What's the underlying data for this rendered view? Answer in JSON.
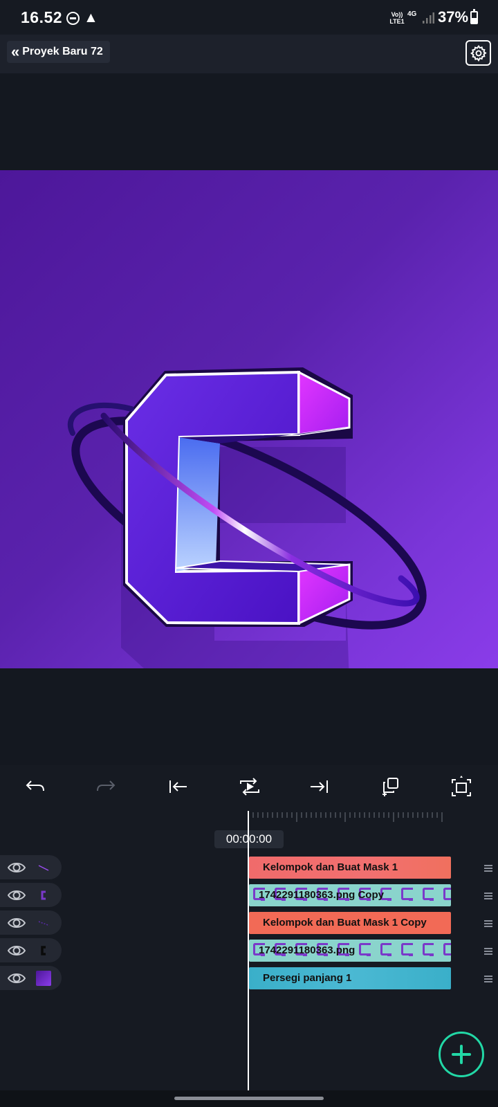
{
  "status_bar": {
    "time": "16.52",
    "volte": "Vo)) LTE1",
    "network": "4G",
    "battery": "37%"
  },
  "header": {
    "project_title": "Proyek Baru 72",
    "icons": [
      "double-chevron-left-icon",
      "gear-icon"
    ]
  },
  "toolbar": {
    "icons": [
      "undo-icon",
      "redo-icon",
      "jump-to-start-icon",
      "play-loop-icon",
      "jump-to-end-icon",
      "duplicate-add-icon",
      "fit-screen-icon"
    ]
  },
  "timeline": {
    "timecode": "00:00:00",
    "layers": [
      {
        "label": "Kelompok dan Buat Mask 1",
        "type": "group",
        "color": "#f06b6b"
      },
      {
        "label": "1742291180363.png Copy",
        "type": "image",
        "color": "#8ad4cc"
      },
      {
        "label": "Kelompok dan Buat Mask 1 Copy",
        "type": "group",
        "color": "#f26a56"
      },
      {
        "label": "1742291180363.png",
        "type": "image",
        "color": "#8ad4cc"
      },
      {
        "label": "Persegi panjang 1",
        "type": "shape",
        "color": "#3aafc9"
      }
    ]
  },
  "colors": {
    "accent": "#22d8a6",
    "canvas_gradient_start": "#4d179a",
    "canvas_gradient_end": "#8a3ce9"
  }
}
